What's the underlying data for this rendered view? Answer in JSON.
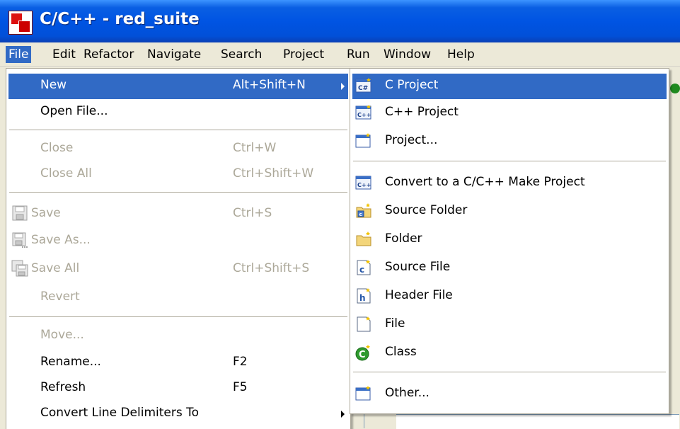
{
  "window": {
    "title": "C/C++ - red_suite"
  },
  "menubar": [
    "File",
    "Edit",
    "Refactor",
    "Navigate",
    "Search",
    "Project",
    "Run",
    "Window",
    "Help"
  ],
  "file_menu": {
    "new": {
      "label": "New",
      "shortcut": "Alt+Shift+N"
    },
    "open_file": {
      "label": "Open File..."
    },
    "close": {
      "label": "Close",
      "shortcut": "Ctrl+W"
    },
    "close_all": {
      "label": "Close All",
      "shortcut": "Ctrl+Shift+W"
    },
    "save": {
      "label": "Save",
      "shortcut": "Ctrl+S",
      "icon": "save-icon"
    },
    "save_as": {
      "label": "Save As...",
      "icon": "save-as-icon"
    },
    "save_all": {
      "label": "Save All",
      "shortcut": "Ctrl+Shift+S",
      "icon": "save-all-icon"
    },
    "revert": {
      "label": "Revert"
    },
    "move": {
      "label": "Move..."
    },
    "rename": {
      "label": "Rename...",
      "shortcut": "F2"
    },
    "refresh": {
      "label": "Refresh",
      "shortcut": "F5"
    },
    "convert_line_delimiters": {
      "label": "Convert Line Delimiters To"
    }
  },
  "new_menu": {
    "c_project": {
      "label": "C Project",
      "icon": "c-project-icon"
    },
    "cpp_project": {
      "label": "C++ Project",
      "icon": "cpp-project-icon"
    },
    "project": {
      "label": "Project...",
      "icon": "project-icon"
    },
    "convert_make": {
      "label": "Convert to a C/C++ Make Project",
      "icon": "convert-project-icon"
    },
    "source_folder": {
      "label": "Source Folder",
      "icon": "source-folder-icon"
    },
    "folder": {
      "label": "Folder",
      "icon": "folder-icon"
    },
    "source_file": {
      "label": "Source File",
      "icon": "source-file-icon"
    },
    "header_file": {
      "label": "Header File",
      "icon": "header-file-icon"
    },
    "file": {
      "label": "File",
      "icon": "file-icon"
    },
    "class": {
      "label": "Class",
      "icon": "class-icon"
    },
    "other": {
      "label": "Other...",
      "icon": "other-wizard-icon"
    }
  },
  "colors": {
    "titlebar": "#0054e3",
    "highlight": "#316ac5",
    "disabled_text": "#aca899",
    "menu_bg": "#ffffff",
    "chrome": "#ece9d8"
  }
}
